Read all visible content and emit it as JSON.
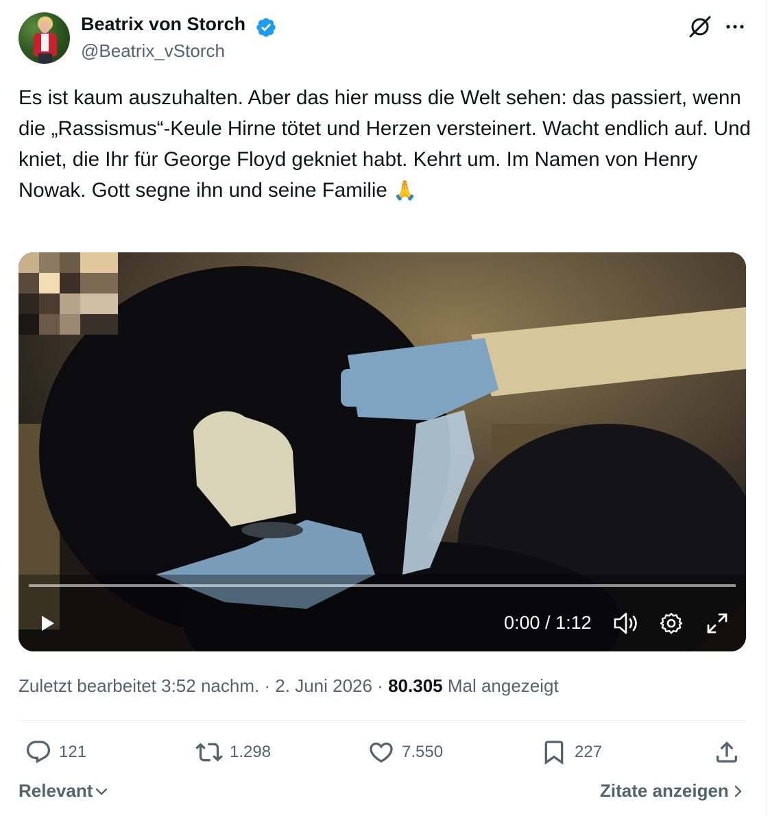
{
  "author": {
    "name": "Beatrix von Storch",
    "handle": "@Beatrix_vStorch",
    "verified": true,
    "verified_color": "#1d9bf0"
  },
  "tweet": {
    "text": "Es ist kaum auszuhalten. Aber das hier muss die Welt sehen: das passiert, wenn die „Rassismus“-Keule Hirne tötet und Herzen versteinert. Wacht endlich auf. Und kniet, die Ihr für George Floyd gekniet habt. Kehrt um. Im Namen von Henry Nowak. Gott segne ihn und seine Familie",
    "emoji": "🙏"
  },
  "video": {
    "time_display": "0:00 / 1:12",
    "progress": 0,
    "controls": [
      "play-icon",
      "volume-icon",
      "settings-icon",
      "fullscreen-icon"
    ]
  },
  "meta": {
    "edited_label": "Zuletzt bearbeitet 3:52 nachm. · 2. Juni 2026 · ",
    "views_count": "80.305",
    "views_label": " Mal angezeigt"
  },
  "actions": {
    "replies": "121",
    "reposts": "1.298",
    "likes": "7.550",
    "bookmarks": "227",
    "icons": [
      "reply-icon",
      "repost-icon",
      "like-icon",
      "bookmark-icon",
      "share-icon"
    ]
  },
  "footer": {
    "sort_label": "Relevant",
    "quotes_label": "Zitate anzeigen"
  },
  "colors": {
    "text": "#0f1419",
    "secondary": "#536471",
    "divider": "#eff3f4"
  }
}
